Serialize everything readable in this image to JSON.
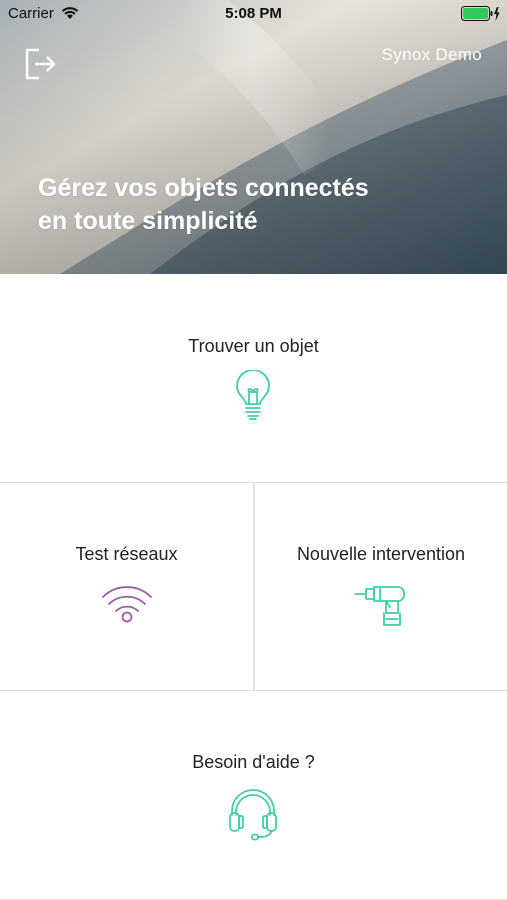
{
  "status_bar": {
    "carrier": "Carrier",
    "time": "5:08 PM",
    "battery_color": "#34c759"
  },
  "header": {
    "logout_icon": "logout-icon",
    "account_name": "Synox Demo",
    "title_line1": "Gérez vos objets connectés",
    "title_line2": "en toute simplicité"
  },
  "tiles": [
    {
      "label": "Trouver un objet",
      "icon": "lightbulb-icon",
      "icon_color": "#3fcfa7"
    },
    {
      "label": "Test réseaux",
      "icon": "wifi-icon",
      "icon_color": "#a05aa8"
    },
    {
      "label": "Nouvelle intervention",
      "icon": "drill-icon",
      "icon_color": "#3fcfa7"
    },
    {
      "label": "Besoin d'aide ?",
      "icon": "headset-icon",
      "icon_color": "#3fcfa7"
    }
  ]
}
